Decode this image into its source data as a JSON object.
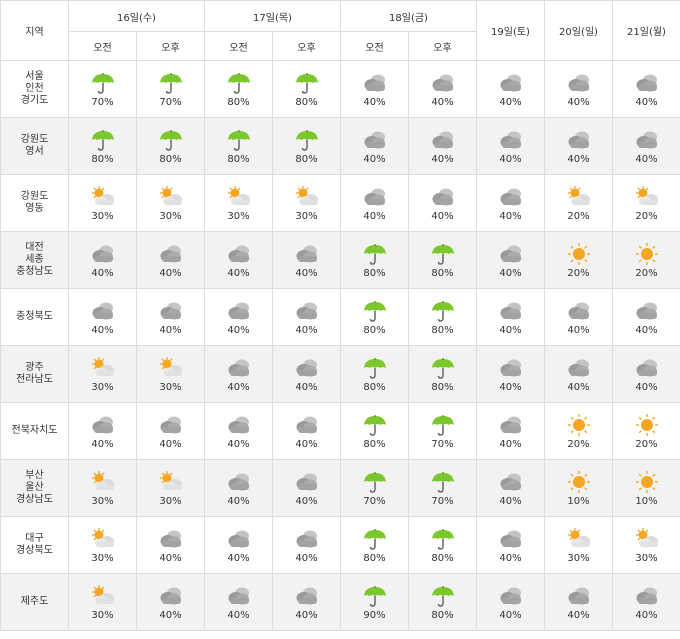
{
  "header": {
    "region_label": "지역",
    "am_label": "오전",
    "pm_label": "오후",
    "split_days": [
      "16일(수)",
      "17일(목)",
      "18일(금)"
    ],
    "single_days": [
      "19일(토)",
      "20일(일)",
      "21일(월)"
    ]
  },
  "icon_names": {
    "rain": "umbrella-icon",
    "cloudy": "cloud-icon",
    "partly": "sun-cloud-icon",
    "sunny": "sun-icon"
  },
  "colors": {
    "umbrella_green": "#7bc72d",
    "cloud_gray": "#9a9a9a",
    "sun_orange": "#f5a623",
    "row_shade": "#f2f2f2",
    "grid": "#dddddd"
  },
  "rows": [
    {
      "region_lines": [
        "서울",
        "인천",
        "경기도"
      ],
      "shaded": false,
      "cells": [
        {
          "icon": "rain",
          "pct": "70%"
        },
        {
          "icon": "rain",
          "pct": "70%"
        },
        {
          "icon": "rain",
          "pct": "80%"
        },
        {
          "icon": "rain",
          "pct": "80%"
        },
        {
          "icon": "cloudy",
          "pct": "40%"
        },
        {
          "icon": "cloudy",
          "pct": "40%"
        },
        {
          "icon": "cloudy",
          "pct": "40%"
        },
        {
          "icon": "cloudy",
          "pct": "40%"
        },
        {
          "icon": "cloudy",
          "pct": "40%"
        }
      ]
    },
    {
      "region_lines": [
        "강원도",
        "영서"
      ],
      "shaded": true,
      "cells": [
        {
          "icon": "rain",
          "pct": "80%"
        },
        {
          "icon": "rain",
          "pct": "80%"
        },
        {
          "icon": "rain",
          "pct": "80%"
        },
        {
          "icon": "rain",
          "pct": "80%"
        },
        {
          "icon": "cloudy",
          "pct": "40%"
        },
        {
          "icon": "cloudy",
          "pct": "40%"
        },
        {
          "icon": "cloudy",
          "pct": "40%"
        },
        {
          "icon": "cloudy",
          "pct": "40%"
        },
        {
          "icon": "cloudy",
          "pct": "40%"
        }
      ]
    },
    {
      "region_lines": [
        "강원도",
        "영동"
      ],
      "shaded": false,
      "cells": [
        {
          "icon": "partly",
          "pct": "30%"
        },
        {
          "icon": "partly",
          "pct": "30%"
        },
        {
          "icon": "partly",
          "pct": "30%"
        },
        {
          "icon": "partly",
          "pct": "30%"
        },
        {
          "icon": "cloudy",
          "pct": "40%"
        },
        {
          "icon": "cloudy",
          "pct": "40%"
        },
        {
          "icon": "cloudy",
          "pct": "40%"
        },
        {
          "icon": "partly",
          "pct": "20%"
        },
        {
          "icon": "partly",
          "pct": "20%"
        }
      ]
    },
    {
      "region_lines": [
        "대전",
        "세종",
        "충청남도"
      ],
      "shaded": true,
      "cells": [
        {
          "icon": "cloudy",
          "pct": "40%"
        },
        {
          "icon": "cloudy",
          "pct": "40%"
        },
        {
          "icon": "cloudy",
          "pct": "40%"
        },
        {
          "icon": "cloudy",
          "pct": "40%"
        },
        {
          "icon": "rain",
          "pct": "80%"
        },
        {
          "icon": "rain",
          "pct": "80%"
        },
        {
          "icon": "cloudy",
          "pct": "40%"
        },
        {
          "icon": "sunny",
          "pct": "20%"
        },
        {
          "icon": "sunny",
          "pct": "20%"
        }
      ]
    },
    {
      "region_lines": [
        "충청북도"
      ],
      "shaded": false,
      "cells": [
        {
          "icon": "cloudy",
          "pct": "40%"
        },
        {
          "icon": "cloudy",
          "pct": "40%"
        },
        {
          "icon": "cloudy",
          "pct": "40%"
        },
        {
          "icon": "cloudy",
          "pct": "40%"
        },
        {
          "icon": "rain",
          "pct": "80%"
        },
        {
          "icon": "rain",
          "pct": "80%"
        },
        {
          "icon": "cloudy",
          "pct": "40%"
        },
        {
          "icon": "cloudy",
          "pct": "40%"
        },
        {
          "icon": "cloudy",
          "pct": "40%"
        }
      ]
    },
    {
      "region_lines": [
        "광주",
        "전라남도"
      ],
      "shaded": true,
      "cells": [
        {
          "icon": "partly",
          "pct": "30%"
        },
        {
          "icon": "partly",
          "pct": "30%"
        },
        {
          "icon": "cloudy",
          "pct": "40%"
        },
        {
          "icon": "cloudy",
          "pct": "40%"
        },
        {
          "icon": "rain",
          "pct": "80%"
        },
        {
          "icon": "rain",
          "pct": "80%"
        },
        {
          "icon": "cloudy",
          "pct": "40%"
        },
        {
          "icon": "cloudy",
          "pct": "40%"
        },
        {
          "icon": "cloudy",
          "pct": "40%"
        }
      ]
    },
    {
      "region_lines": [
        "전북자치도"
      ],
      "shaded": false,
      "cells": [
        {
          "icon": "cloudy",
          "pct": "40%"
        },
        {
          "icon": "cloudy",
          "pct": "40%"
        },
        {
          "icon": "cloudy",
          "pct": "40%"
        },
        {
          "icon": "cloudy",
          "pct": "40%"
        },
        {
          "icon": "rain",
          "pct": "80%"
        },
        {
          "icon": "rain",
          "pct": "70%"
        },
        {
          "icon": "cloudy",
          "pct": "40%"
        },
        {
          "icon": "sunny",
          "pct": "20%"
        },
        {
          "icon": "sunny",
          "pct": "20%"
        }
      ]
    },
    {
      "region_lines": [
        "부산",
        "울산",
        "경상남도"
      ],
      "shaded": true,
      "cells": [
        {
          "icon": "partly",
          "pct": "30%"
        },
        {
          "icon": "partly",
          "pct": "30%"
        },
        {
          "icon": "cloudy",
          "pct": "40%"
        },
        {
          "icon": "cloudy",
          "pct": "40%"
        },
        {
          "icon": "rain",
          "pct": "70%"
        },
        {
          "icon": "rain",
          "pct": "70%"
        },
        {
          "icon": "cloudy",
          "pct": "40%"
        },
        {
          "icon": "sunny",
          "pct": "10%"
        },
        {
          "icon": "sunny",
          "pct": "10%"
        }
      ]
    },
    {
      "region_lines": [
        "대구",
        "경상북도"
      ],
      "shaded": false,
      "cells": [
        {
          "icon": "partly",
          "pct": "30%"
        },
        {
          "icon": "cloudy",
          "pct": "40%"
        },
        {
          "icon": "cloudy",
          "pct": "40%"
        },
        {
          "icon": "cloudy",
          "pct": "40%"
        },
        {
          "icon": "rain",
          "pct": "80%"
        },
        {
          "icon": "rain",
          "pct": "80%"
        },
        {
          "icon": "cloudy",
          "pct": "40%"
        },
        {
          "icon": "partly",
          "pct": "30%"
        },
        {
          "icon": "partly",
          "pct": "30%"
        }
      ]
    },
    {
      "region_lines": [
        "제주도"
      ],
      "shaded": true,
      "cells": [
        {
          "icon": "partly",
          "pct": "30%"
        },
        {
          "icon": "cloudy",
          "pct": "40%"
        },
        {
          "icon": "cloudy",
          "pct": "40%"
        },
        {
          "icon": "cloudy",
          "pct": "40%"
        },
        {
          "icon": "rain",
          "pct": "90%"
        },
        {
          "icon": "rain",
          "pct": "80%"
        },
        {
          "icon": "cloudy",
          "pct": "40%"
        },
        {
          "icon": "cloudy",
          "pct": "40%"
        },
        {
          "icon": "cloudy",
          "pct": "40%"
        }
      ]
    }
  ]
}
